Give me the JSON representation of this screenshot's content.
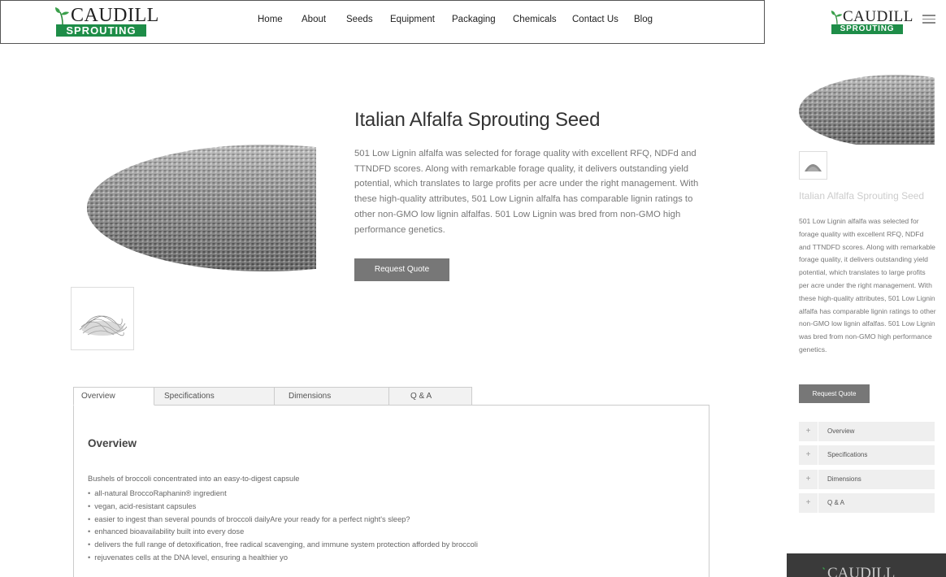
{
  "brand": {
    "name": "CAUDILL",
    "tagline": "SPROUTING",
    "accent_green": "#1e8d48"
  },
  "nav": [
    "Home",
    "About",
    "Seeds",
    "Equipment",
    "Packaging",
    "Chemicals",
    "Contact Us",
    "Blog"
  ],
  "product": {
    "title": "Italian Alfalfa Sprouting Seed",
    "description": "501 Low Lignin alfalfa was selected for forage quality with excellent RFQ, NDFd and TTNDFD scores.  Along with remarkable forage quality, it delivers outstanding yield potential, which translates to large profits per acre under the right management. With these high-quality attributes, 501 Low Lignin alfalfa has comparable lignin ratings to other non-GMO low lignin alfalfas. 501 Low Lignin was bred from non-GMO high performance genetics.",
    "cta": "Request Quote"
  },
  "tabs": [
    "Overview",
    "Specifications",
    "Dimensions",
    "Q & A"
  ],
  "overview": {
    "heading": "Overview",
    "intro": "Bushels of broccoli concentrated into an easy-to-digest capsule",
    "bullets": [
      "all-natural BroccoRaphanin® ingredient",
      "vegan, acid-resistant capsules",
      "easier to ingest than several pounds of broccoli dailyAre your ready for a perfect night's sleep?",
      "enhanced bioavailability built into every dose",
      "delivers the full range of detoxification, free radical scavenging, and immune system protection afforded by broccoli",
      "rejuvenates cells at the DNA level, ensuring a healthier yo"
    ]
  },
  "mobile": {
    "accordion": [
      "Overview",
      "Specifications",
      "Dimensions",
      "Q & A"
    ],
    "accordion_icon": "+",
    "menu_icon": "hamburger-icon"
  }
}
